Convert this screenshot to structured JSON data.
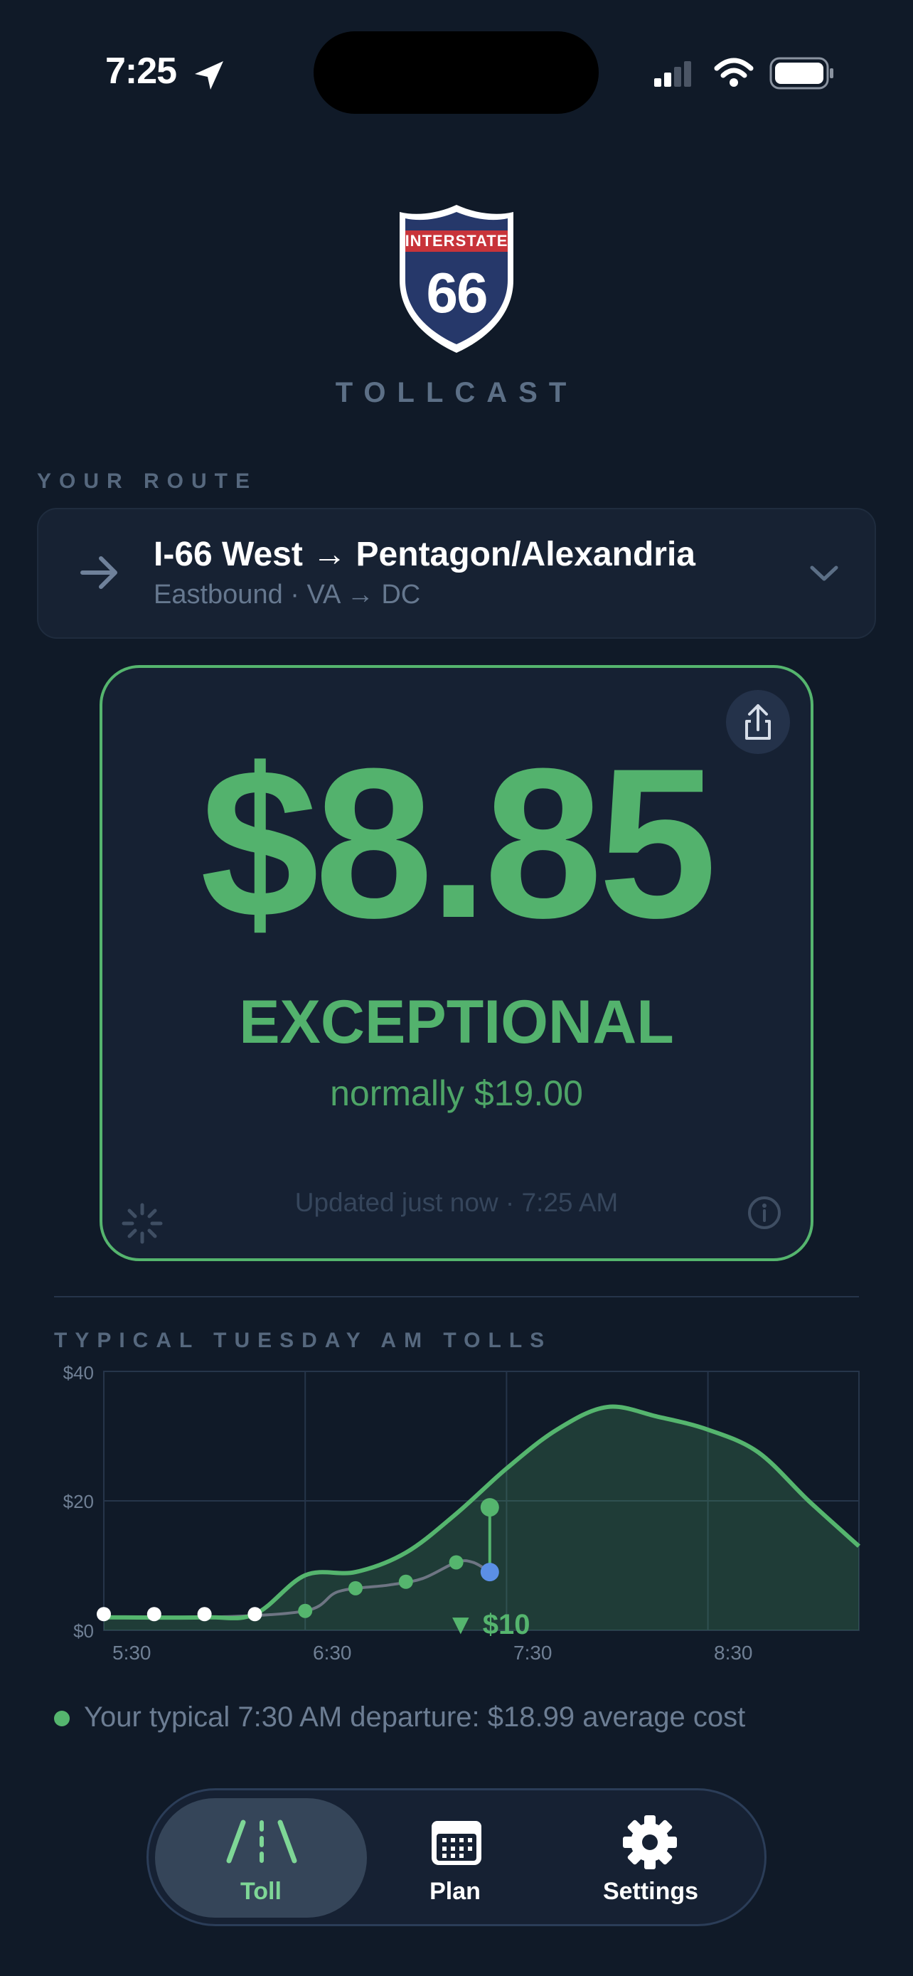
{
  "status_bar": {
    "time": "7:25"
  },
  "logo": {
    "shield_top": "INTERSTATE",
    "shield_number": "66",
    "wordmark": "TOLLCAST"
  },
  "route": {
    "section_label": "YOUR ROUTE",
    "title": "I-66 West → Pentagon/Alexandria",
    "subtitle": "Eastbound · VA → DC"
  },
  "toll": {
    "price": "$8.85",
    "rating": "EXCEPTIONAL",
    "normally": "normally $19.00",
    "updated": "Updated just now · 7:25 AM"
  },
  "chart_data": {
    "type": "line",
    "title": "TYPICAL TUESDAY AM TOLLS",
    "y_tick_labels": [
      "$40",
      "$20",
      "$0"
    ],
    "x_tick_labels": [
      "5:30",
      "6:30",
      "7:30",
      "8:30"
    ],
    "ylim": [
      0,
      40
    ],
    "xlim": [
      "5:30",
      "9:15"
    ],
    "grid": true,
    "series": [
      {
        "style": "green-filled-line",
        "points": [
          [
            "5:30",
            2.0
          ],
          [
            "6:00",
            2.0
          ],
          [
            "6:15",
            2.5
          ],
          [
            "6:30",
            8.5
          ],
          [
            "6:45",
            9.0
          ],
          [
            "7:00",
            12.0
          ],
          [
            "7:15",
            18.0
          ],
          [
            "7:30",
            25.0
          ],
          [
            "7:45",
            31.0
          ],
          [
            "8:00",
            34.5
          ],
          [
            "8:15",
            33.0
          ],
          [
            "8:30",
            31.0
          ],
          [
            "8:45",
            27.5
          ],
          [
            "9:00",
            20.0
          ],
          [
            "9:15",
            13.0
          ]
        ]
      },
      {
        "style": "gray-line",
        "points": [
          [
            "5:30",
            2.0
          ],
          [
            "6:00",
            2.0
          ],
          [
            "6:30",
            3.0
          ],
          [
            "6:40",
            6.0
          ],
          [
            "6:55",
            7.0
          ],
          [
            "7:05",
            8.0
          ],
          [
            "7:15",
            10.5
          ],
          [
            "7:20",
            10.5
          ],
          [
            "7:25",
            9.0
          ]
        ]
      }
    ],
    "markers_white": [
      [
        "5:30",
        2.5
      ],
      [
        "5:45",
        2.5
      ],
      [
        "6:00",
        2.5
      ],
      [
        "6:15",
        2.5
      ]
    ],
    "markers_green": [
      [
        "6:30",
        3.0
      ],
      [
        "6:45",
        6.5
      ],
      [
        "7:00",
        7.5
      ],
      [
        "7:15",
        10.5
      ]
    ],
    "current_marker": [
      "7:25",
      9.0
    ],
    "typical_marker": [
      "7:25",
      19.0
    ],
    "annotation": "▼ $10"
  },
  "footnote": "Your typical 7:30 AM departure: $18.99 average cost",
  "tabs": [
    {
      "label": "Toll",
      "icon": "road-icon",
      "active": true
    },
    {
      "label": "Plan",
      "icon": "calendar-icon",
      "active": false
    },
    {
      "label": "Settings",
      "icon": "gear-icon",
      "active": false
    }
  ],
  "colors": {
    "accent_green": "#55b56e",
    "background": "#101a28",
    "blue_marker": "#5b8fe6",
    "shield_blue": "#26386a",
    "shield_red": "#c8343a"
  }
}
